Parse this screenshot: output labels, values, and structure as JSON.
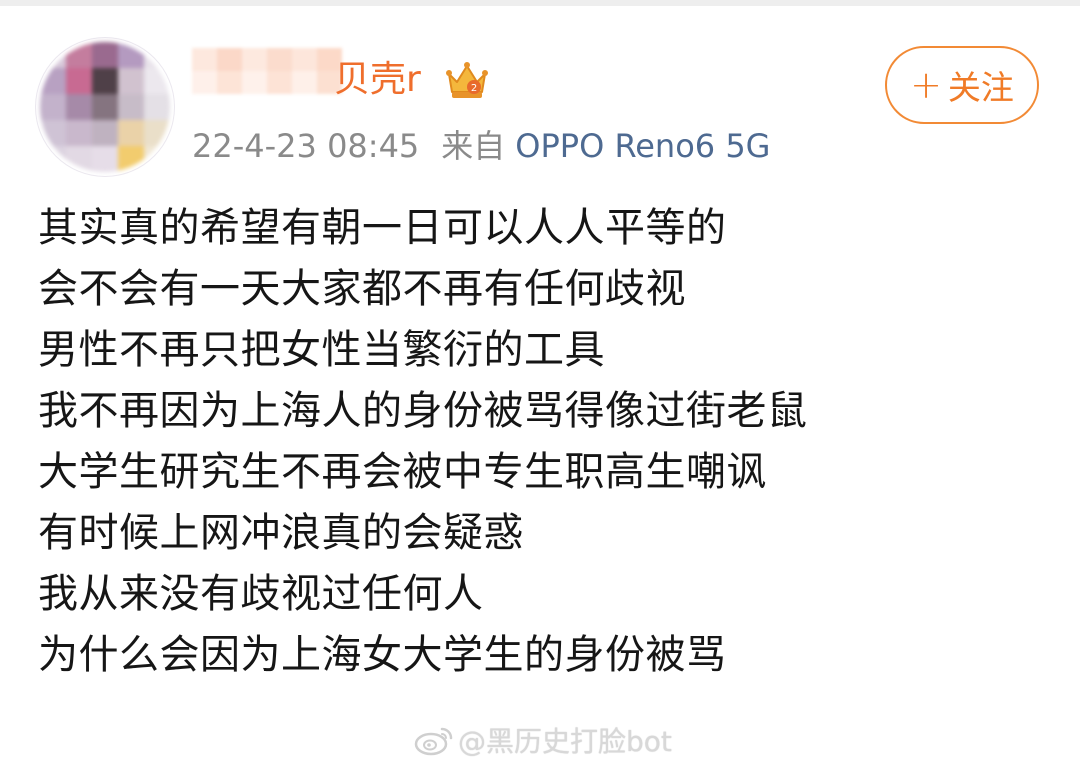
{
  "user": {
    "name_visible": "贝壳r",
    "badge_icon": "crown-icon",
    "avatar_icon": "avatar-icon"
  },
  "meta": {
    "timestamp": "22-4-23 08:45",
    "source_label": "来自",
    "device": "OPPO Reno6 5G"
  },
  "follow_button": {
    "plus": "+",
    "label": "关注"
  },
  "post": {
    "lines": [
      "其实真的希望有朝一日可以人人平等的",
      "会不会有一天大家都不再有任何歧视",
      "男性不再只把女性当繁衍的工具",
      "我不再因为上海人的身份被骂得像过街老鼠",
      "大学生研究生不再会被中专生职高生嘲讽",
      "有时候上网冲浪真的会疑惑",
      "我从来没有歧视过任何人",
      "为什么会因为上海女大学生的身份被骂"
    ]
  },
  "watermark": {
    "text": "@黑历史打脸bot",
    "icon": "weibo-logo-icon"
  },
  "colors": {
    "accent": "#f07b27",
    "device_link": "#4e6a91",
    "meta_gray": "#8a8a8a",
    "body_text": "#161616"
  }
}
